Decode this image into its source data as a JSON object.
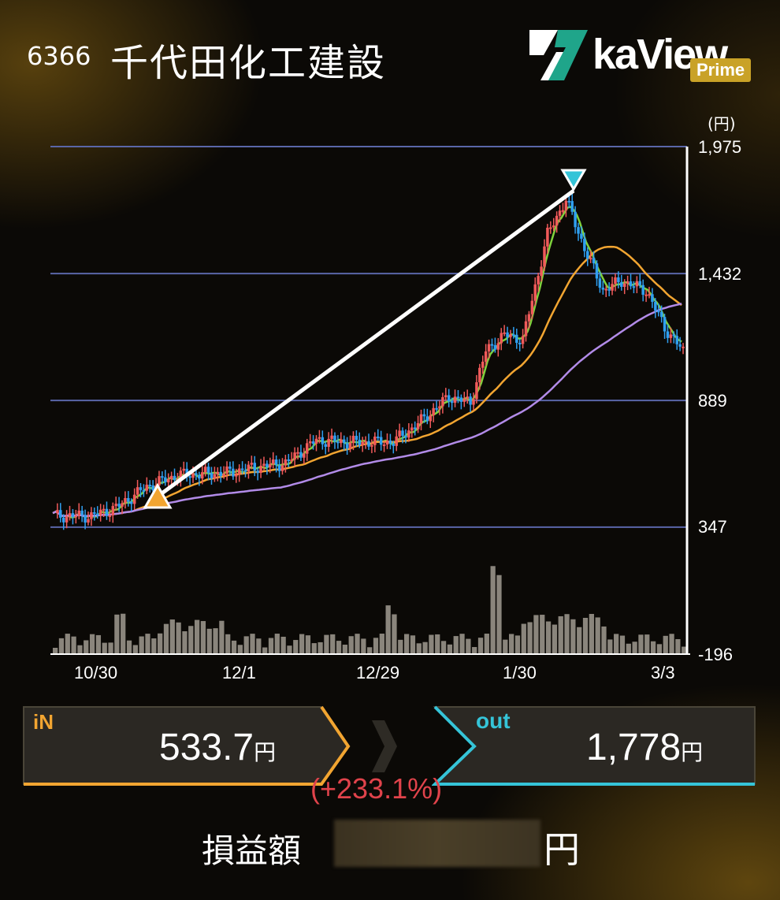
{
  "header": {
    "code": "6366",
    "name": "千代田化工建設"
  },
  "logo": {
    "text": "kaView",
    "badge": "Prime"
  },
  "chart_data": {
    "type": "candlestick",
    "unit": "(円)",
    "y_ticks": [
      "1,975",
      "1,432",
      "889",
      "347",
      "-196"
    ],
    "x_ticks": [
      "10/30",
      "12/1",
      "12/29",
      "1/30",
      "3/3"
    ],
    "ylim": [
      -196,
      1975
    ],
    "series": [
      {
        "name": "",
        "type": "candles"
      },
      {
        "name": "",
        "type": "ma_short",
        "color": "#7fd23c"
      },
      {
        "name": "",
        "type": "ma_mid",
        "color": "#f2a531"
      },
      {
        "name": "",
        "type": "ma_long",
        "color": "#b28be8"
      }
    ],
    "colors": {
      "up": "#f05a5a",
      "down": "#2f9ff0",
      "volume": "#8a857c",
      "grid": "#5a66a8"
    },
    "entry_marker": {
      "price": 533.7,
      "color": "#f2a531"
    },
    "exit_marker": {
      "price": 1778,
      "color": "#35c4d8"
    }
  },
  "trade": {
    "in_label": "iN",
    "in_value": "533.7",
    "in_unit": "円",
    "out_label": "out",
    "out_value": "1,778",
    "out_unit": "円",
    "change": "(+233.1%)",
    "pnl_label": "損益額",
    "pnl_unit": "円"
  }
}
